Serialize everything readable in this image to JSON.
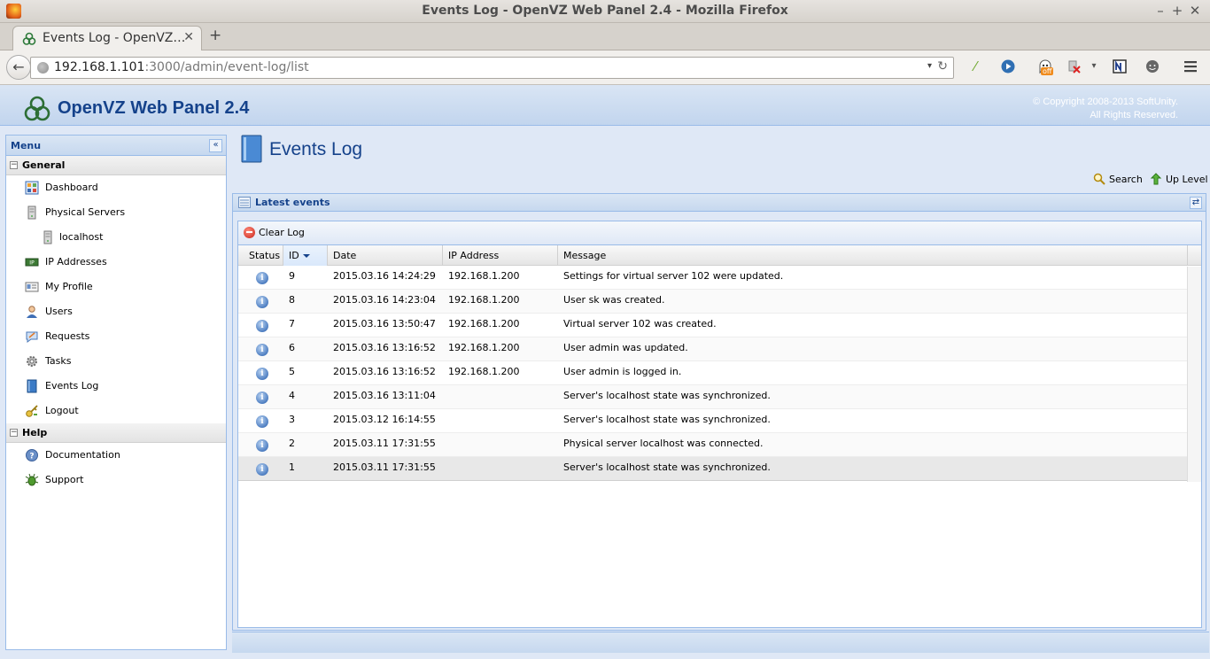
{
  "window": {
    "title": "Events Log - OpenVZ Web Panel 2.4 - Mozilla Firefox",
    "minimize": "–",
    "maximize": "+",
    "close": "✕"
  },
  "browser": {
    "tab_label": "Events Log - OpenVZ…",
    "tab_close": "✕",
    "new_tab": "+",
    "back": "←",
    "url_host": "192.168.1.101",
    "url_path": ":3000/admin/event-log/list",
    "url_dropdown": "▾",
    "reload": "↻",
    "toolbar_icons": [
      "pen-icon",
      "play-icon",
      "ghostery-icon",
      "blocker-icon",
      "dropdown-icon",
      "note-icon",
      "chat-icon",
      "hamburger-menu-icon"
    ],
    "ghostery_badge": "off"
  },
  "app": {
    "brand_title": "OpenVZ Web Panel 2.4",
    "copyright_line1": "© Copyright 2008-2013 SoftUnity.",
    "copyright_line2": "All Rights Reserved."
  },
  "menu": {
    "header": "Menu",
    "collapse_glyph": "«",
    "groups": [
      {
        "label": "General",
        "toggle": "−",
        "items": [
          {
            "label": "Dashboard",
            "icon": "dashboard-icon"
          },
          {
            "label": "Physical Servers",
            "icon": "server-icon"
          },
          {
            "label": "localhost",
            "icon": "server-icon"
          },
          {
            "label": "IP Addresses",
            "icon": "ip-address-icon"
          },
          {
            "label": "My Profile",
            "icon": "profile-card-icon"
          },
          {
            "label": "Users",
            "icon": "users-icon"
          },
          {
            "label": "Requests",
            "icon": "request-icon"
          },
          {
            "label": "Tasks",
            "icon": "gear-icon"
          },
          {
            "label": "Events Log",
            "icon": "book-icon"
          },
          {
            "label": "Logout",
            "icon": "key-icon"
          }
        ]
      },
      {
        "label": "Help",
        "toggle": "−",
        "items": [
          {
            "label": "Documentation",
            "icon": "help-icon"
          },
          {
            "label": "Support",
            "icon": "bug-icon"
          }
        ]
      }
    ]
  },
  "main": {
    "title": "Events Log",
    "toolbar": {
      "search": "Search",
      "up_level": "Up Level"
    },
    "panel_title": "Latest events",
    "refresh_glyph": "⇄",
    "clear_log": "Clear Log",
    "columns": [
      "Status",
      "ID",
      "Date",
      "IP Address",
      "Message"
    ],
    "rows": [
      {
        "status": "i",
        "id": "9",
        "date": "2015.03.16 14:24:29",
        "ip": "192.168.1.200",
        "message": "Settings for virtual server 102 were updated."
      },
      {
        "status": "i",
        "id": "8",
        "date": "2015.03.16 14:23:04",
        "ip": "192.168.1.200",
        "message": "User sk was created."
      },
      {
        "status": "i",
        "id": "7",
        "date": "2015.03.16 13:50:47",
        "ip": "192.168.1.200",
        "message": "Virtual server 102 was created."
      },
      {
        "status": "i",
        "id": "6",
        "date": "2015.03.16 13:16:52",
        "ip": "192.168.1.200",
        "message": "User admin was updated."
      },
      {
        "status": "i",
        "id": "5",
        "date": "2015.03.16 13:16:52",
        "ip": "192.168.1.200",
        "message": "User admin is logged in."
      },
      {
        "status": "i",
        "id": "4",
        "date": "2015.03.16 13:11:04",
        "ip": "",
        "message": "Server's localhost state was synchronized."
      },
      {
        "status": "i",
        "id": "3",
        "date": "2015.03.12 16:14:55",
        "ip": "",
        "message": "Server's localhost state was synchronized."
      },
      {
        "status": "i",
        "id": "2",
        "date": "2015.03.11 17:31:55",
        "ip": "",
        "message": "Physical server localhost was connected."
      },
      {
        "status": "i",
        "id": "1",
        "date": "2015.03.11 17:31:55",
        "ip": "",
        "message": "Server's localhost state was synchronized."
      }
    ],
    "selected_row_id": "1",
    "colors": {
      "accent": "#15428b",
      "panel_border": "#99bbe8",
      "panel_bg": "#dfe8f6"
    }
  }
}
